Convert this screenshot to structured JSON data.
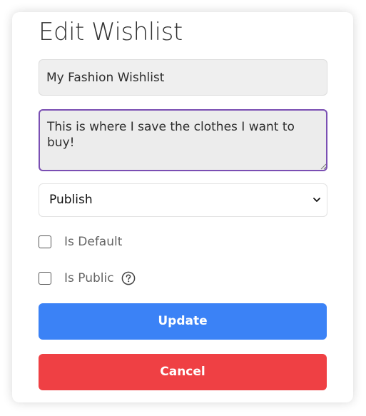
{
  "form": {
    "title": "Edit Wishlist",
    "name_value": "My Fashion Wishlist",
    "description_value": "This is where I save the clothes I want to buy!",
    "status_selected": "Publish",
    "is_default_label": "Is Default",
    "is_default_checked": false,
    "is_public_label": "Is Public",
    "is_public_checked": false,
    "help_icon": "question-circle-icon",
    "update_label": "Update",
    "cancel_label": "Cancel"
  },
  "colors": {
    "update_button": "#3b82f6",
    "cancel_button": "#ef4044",
    "focus_border": "#7a4fb3"
  }
}
